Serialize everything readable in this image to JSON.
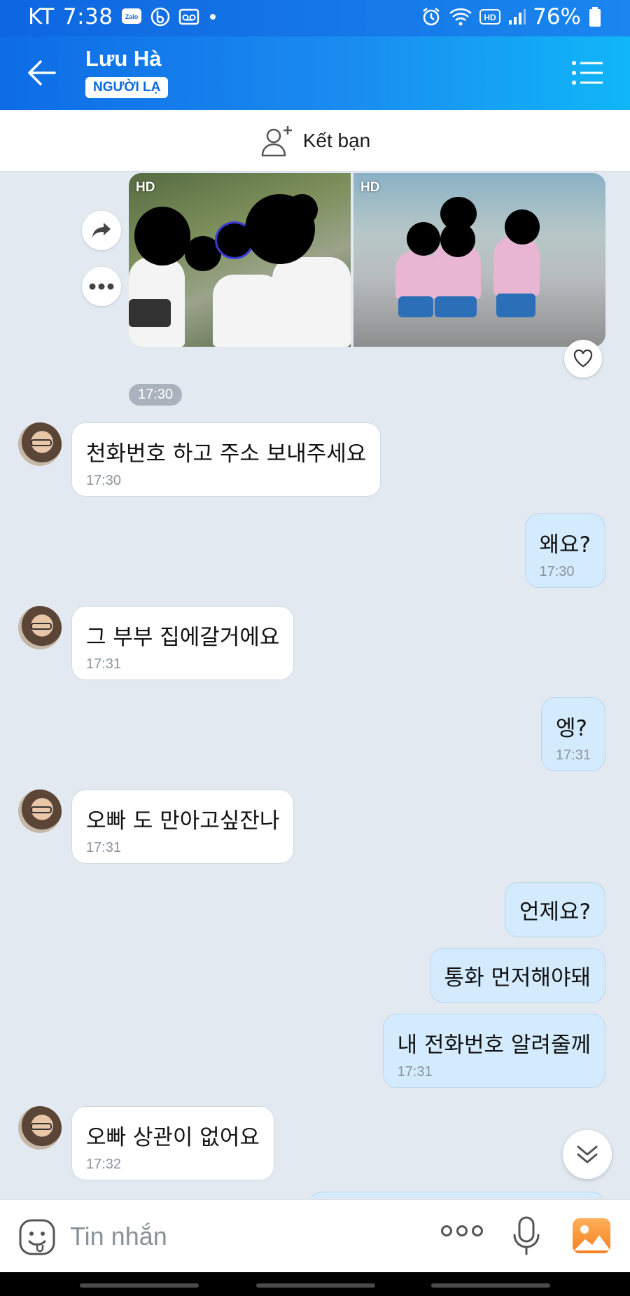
{
  "status_bar": {
    "carrier": "KT",
    "time": "7:38",
    "left_icons": [
      "zalo-icon",
      "blog-icon",
      "voicemail-icon",
      "dot-icon"
    ],
    "zalo_text": "Zalo",
    "right_icons": [
      "alarm-icon",
      "wifi-icon",
      "hd-icon",
      "signal-icon",
      "battery-icon"
    ],
    "hd_text": "HD",
    "battery": "76%"
  },
  "header": {
    "back_icon": "arrow-left-icon",
    "title": "Lưu Hà",
    "badge": "NGƯỜI LẠ",
    "menu_icon": "list-menu-icon"
  },
  "add_friend": {
    "icon": "add-person-icon",
    "label": "Kết bạn"
  },
  "shared_photos": {
    "photos": [
      {
        "badge": "HD"
      },
      {
        "badge": "HD"
      }
    ],
    "actions": [
      "share-icon",
      "more-dots-icon",
      "heart-icon"
    ]
  },
  "time_chip": "17:30",
  "messages": [
    {
      "side": "in",
      "text": "천화번호 하고 주소 보내주세요",
      "time": "17:30"
    },
    {
      "side": "out",
      "text": "왜요?",
      "time": "17:30"
    },
    {
      "side": "in",
      "text": "그 부부 집에갈거에요",
      "time": "17:31"
    },
    {
      "side": "out",
      "text": "엥?",
      "time": "17:31"
    },
    {
      "side": "in",
      "text": "오빠 도 만아고싶잔나",
      "time": "17:31"
    },
    {
      "side": "out",
      "text": "언제요?",
      "time": ""
    },
    {
      "side": "out",
      "text": "통화 먼저해야돼",
      "time": ""
    },
    {
      "side": "out",
      "text": "내 전화번호 알려줄께",
      "time": "17:31"
    },
    {
      "side": "in",
      "text": "오빠 상관이 없어요",
      "time": "17:32"
    }
  ],
  "scroll_icon": "chevron-double-down-icon",
  "input_bar": {
    "placeholder": "Tin nhắn",
    "icons": [
      "emoji-icon",
      "more-dots-icon",
      "microphone-icon",
      "gallery-icon"
    ]
  },
  "colors": {
    "header_start": "#0d6ce6",
    "header_end": "#10b6f8",
    "chat_bg": "#e2e9f1",
    "bubble_out": "#d3ebfd",
    "bubble_in": "#ffffff",
    "badge_text": "#0a6be0"
  }
}
